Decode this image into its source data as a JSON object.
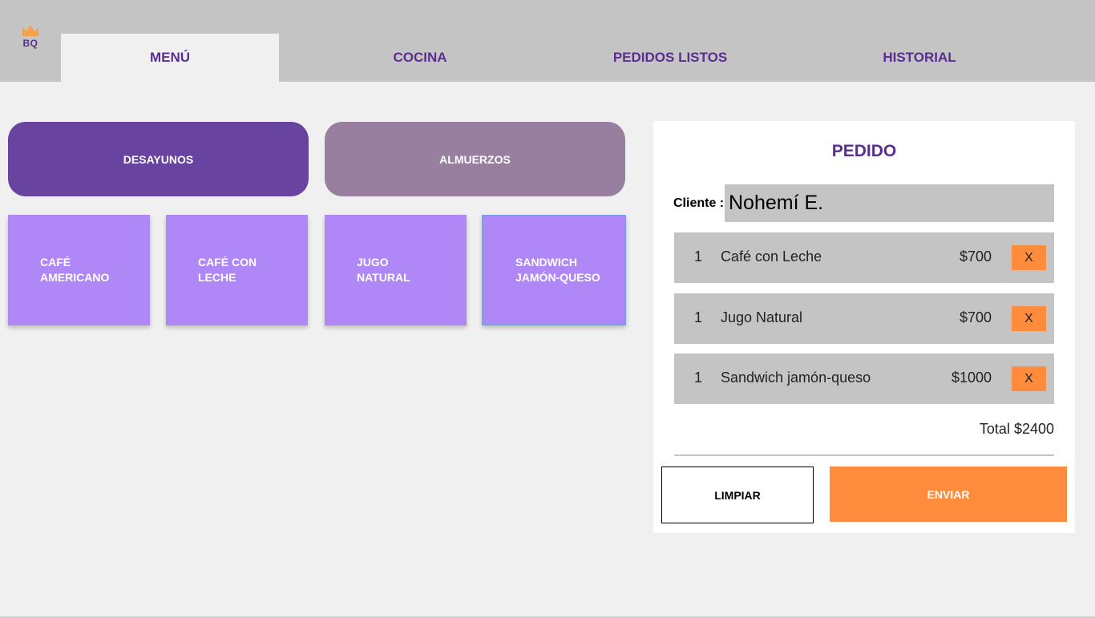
{
  "logo": {
    "text": "BQ",
    "icon": "crown-icon"
  },
  "tabs": [
    {
      "label": "MENÚ",
      "active": true
    },
    {
      "label": "COCINA",
      "active": false
    },
    {
      "label": "PEDIDOS LISTOS",
      "active": false
    },
    {
      "label": "HISTORIAL",
      "active": false
    }
  ],
  "categories": [
    {
      "label": "DESAYUNOS",
      "active": true
    },
    {
      "label": "ALMUERZOS",
      "active": false
    }
  ],
  "menu_items": [
    {
      "line1": "CAFÉ",
      "line2": "AMERICANO"
    },
    {
      "line1": "CAFÉ CON",
      "line2": "LECHE"
    },
    {
      "line1": "JUGO",
      "line2": "NATURAL"
    },
    {
      "line1": "SANDWICH",
      "line2": "JAMÓN-QUESO"
    }
  ],
  "order": {
    "title": "PEDIDO",
    "client_label": "Cliente :",
    "client_value": "Nohemí E.",
    "rows": [
      {
        "qty": "1",
        "name": "Café con Leche",
        "price": "$700",
        "remove": "X"
      },
      {
        "qty": "1",
        "name": "Jugo Natural",
        "price": "$700",
        "remove": "X"
      },
      {
        "qty": "1",
        "name": "Sandwich jamón-queso",
        "price": "$1000",
        "remove": "X"
      }
    ],
    "total": "Total $2400",
    "clear_label": "LIMPIAR",
    "send_label": "ENVIAR"
  },
  "colors": {
    "brand_purple": "#5b2d91",
    "category_active": "#6843a0",
    "category_inactive": "#997f9f",
    "item_card": "#b087f7",
    "accent_orange": "#ff8b3d",
    "bar_gray": "#c4c4c4"
  }
}
